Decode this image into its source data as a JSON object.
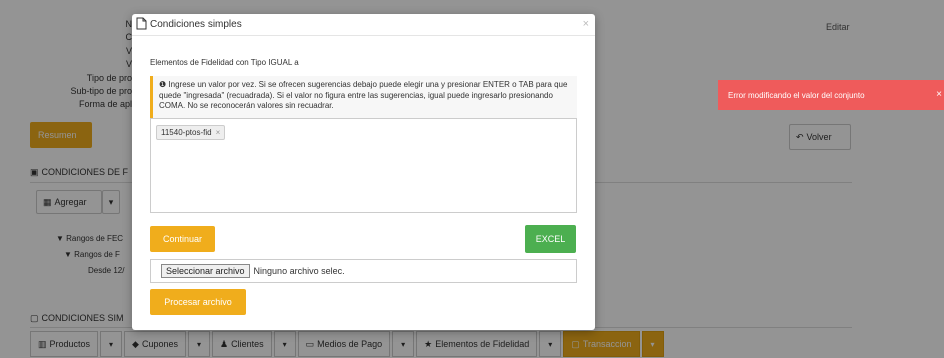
{
  "background": {
    "labels": [
      "N",
      "C",
      "V",
      "V",
      "Tipo de pro",
      "Sub-tipo de pro",
      "Forma de apl"
    ],
    "edit_label": "Editar",
    "resumen_button": "Resumen",
    "volver_button": "Volver",
    "section1_title": "CONDICIONES DE F",
    "agregar_button": "Agregar",
    "tree": [
      "Rangos de FEC",
      "Rangos de F",
      "Desde 12/"
    ],
    "section2_title": "CONDICIONES SIM",
    "tabs": [
      {
        "label": "Productos",
        "icon": "barcode-icon"
      },
      {
        "label": "Cupones",
        "icon": "tag-icon"
      },
      {
        "label": "Clientes",
        "icon": "users-icon"
      },
      {
        "label": "Medios de Pago",
        "icon": "credit-card-icon"
      },
      {
        "label": "Elementos de Fidelidad",
        "icon": "star-icon"
      },
      {
        "label": "Transaccion",
        "icon": "file-icon"
      }
    ]
  },
  "toast": {
    "message": "Error modificando el valor del conjunto",
    "close": "×",
    "color": "#ef5b5b"
  },
  "modal": {
    "title": "Condiciones simples",
    "close": "×",
    "subtitle": "Elementos de Fidelidad con Tipo IGUAL a",
    "info": "Ingrese un valor por vez. Si se ofrecen sugerencias debajo puede elegir una y presionar ENTER o TAB para que quede \"ingresada\" (recuadrada). Si el valor no figura entre las sugerencias, igual puede ingresarlo presionando COMA. No se reconocerán valores sin recuadrar.",
    "tag_value": "11540-ptos-fid",
    "tag_remove": "×",
    "continue_button": "Continuar",
    "excel_button": "EXCEL",
    "file_button": "Seleccionar archivo",
    "file_status": "Ninguno archivo selec.",
    "process_button": "Procesar archivo"
  },
  "colors": {
    "accent": "#f0ad1c",
    "success": "#4caf50"
  }
}
